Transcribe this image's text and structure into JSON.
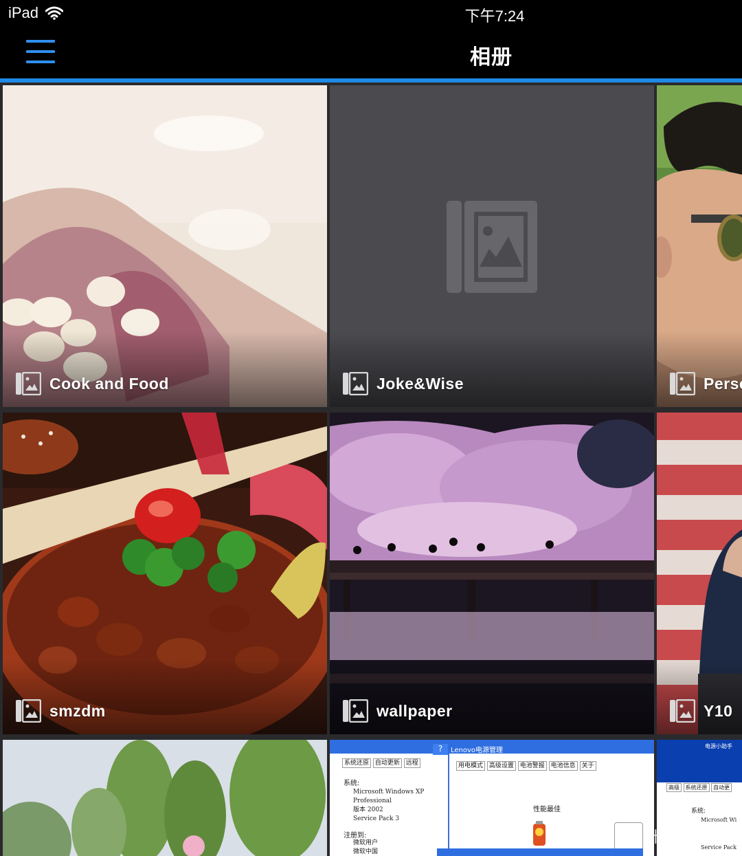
{
  "status_bar": {
    "device": "iPad",
    "time": "下午7:24"
  },
  "nav": {
    "title": "相册",
    "menu_icon": "hamburger-menu-icon"
  },
  "colors": {
    "accent": "#1f8ae6",
    "background": "#000000",
    "placeholder_tile": "#4a4a4f"
  },
  "albums": [
    {
      "name": "Cook and Food",
      "cover": "garlic-on-cutting-board-photo"
    },
    {
      "name": "Joke&Wise",
      "cover": "placeholder-image-icon"
    },
    {
      "name": "Perso",
      "cover": "man-with-sunglasses-portrait-photo"
    },
    {
      "name": "smzdm",
      "cover": "stew-with-parsley-and-chili-photo"
    },
    {
      "name": "wallpaper",
      "cover": "cherry-blossom-night-bridge-photo"
    },
    {
      "name": "Y10",
      "cover": "man-in-suit-flag-backdrop-photo"
    },
    {
      "name": "",
      "cover": "trees-in-park-photo"
    },
    {
      "name": "",
      "cover": "lenovo-power-manager-screenshot"
    },
    {
      "name": "",
      "cover": "windows-system-properties-screenshot"
    }
  ],
  "screenshot_text": {
    "window_title": "Lenovo电源管理",
    "tabs": [
      "用电模式",
      "高级设置",
      "电池警报",
      "电池信息",
      "关于"
    ],
    "left_tabs": [
      "系统还原",
      "自动更新",
      "远程"
    ],
    "system_label": "系统:",
    "os_lines": [
      "Microsoft Windows XP",
      "Professional",
      "版本 2002",
      "Service Pack 3"
    ],
    "registered_label": "注册到:",
    "registered_lines": [
      "微软用户",
      "微软中国"
    ],
    "mode_label": "性能最佳",
    "right_tabs": [
      "高级",
      "系统还原",
      "自动更"
    ],
    "right_system_label": "系统:",
    "right_os_lines": [
      "Microsoft Wi",
      "Service Pack"
    ],
    "right_assistant": "电源小助手"
  },
  "watermark": "值 什么值得买"
}
